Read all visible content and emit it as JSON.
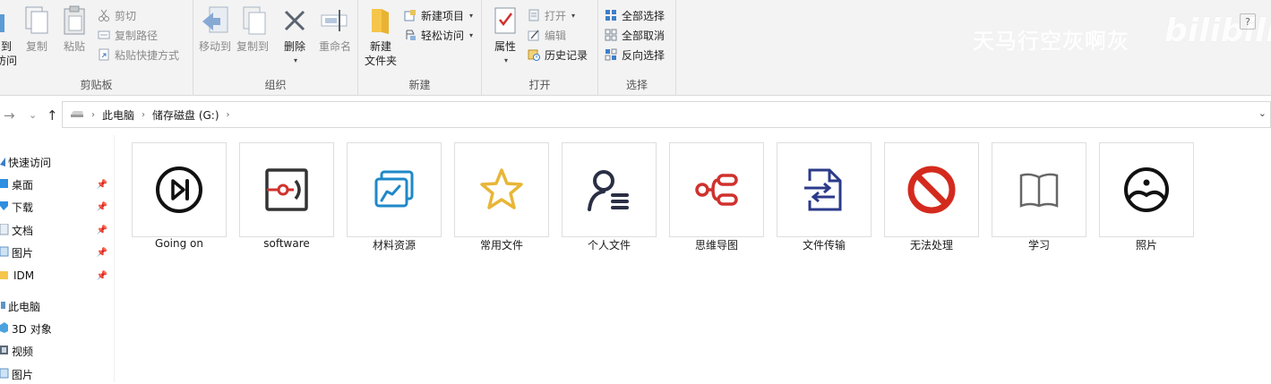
{
  "ribbon": {
    "clipboard": {
      "label": "剪贴板",
      "pin_partial": "到",
      "pin_partial2": "访问",
      "copy": "复制",
      "paste": "粘贴",
      "cut": "剪切",
      "copy_path": "复制路径",
      "paste_shortcut": "粘贴快捷方式"
    },
    "organize": {
      "label": "组织",
      "move_to": "移动到",
      "copy_to": "复制到",
      "delete": "删除",
      "rename": "重命名"
    },
    "new": {
      "label": "新建",
      "new_folder_line1": "新建",
      "new_folder_line2": "文件夹",
      "new_item": "新建项目",
      "easy_access": "轻松访问"
    },
    "open": {
      "label": "打开",
      "properties": "属性",
      "open": "打开",
      "edit": "编辑",
      "history": "历史记录"
    },
    "select": {
      "label": "选择",
      "select_all": "全部选择",
      "select_none": "全部取消",
      "invert": "反向选择"
    },
    "watermark": "天马行空灰啊灰",
    "bili": "bilibili",
    "help": "?"
  },
  "address": {
    "crumbs": [
      "此电脑",
      "储存磁盘 (G:)"
    ]
  },
  "sidebar": {
    "quick_access": "快速访问",
    "items": [
      "桌面",
      "下载",
      "文档",
      "图片",
      "IDM"
    ],
    "this_pc": "此电脑",
    "pc_items": [
      "3D 对象",
      "视频",
      "图片"
    ]
  },
  "folders": [
    {
      "name": "Going on",
      "icon": "play-next-icon",
      "color": "#111111"
    },
    {
      "name": "software",
      "icon": "software-box-icon",
      "color": "#d0312d"
    },
    {
      "name": "材料资源",
      "icon": "chart-cards-icon",
      "color": "#1e88c8"
    },
    {
      "name": "常用文件",
      "icon": "star-icon",
      "color": "#e8b637"
    },
    {
      "name": "个人文件",
      "icon": "person-list-icon",
      "color": "#2a2f45"
    },
    {
      "name": "思维导图",
      "icon": "mindmap-icon",
      "color": "#d0312d"
    },
    {
      "name": "文件传输",
      "icon": "file-transfer-icon",
      "color": "#2b3a8a"
    },
    {
      "name": "无法处理",
      "icon": "forbidden-icon",
      "color": "#d42a1e"
    },
    {
      "name": "学习",
      "icon": "book-icon",
      "color": "#666666"
    },
    {
      "name": "照片",
      "icon": "photo-face-icon",
      "color": "#111111"
    }
  ]
}
